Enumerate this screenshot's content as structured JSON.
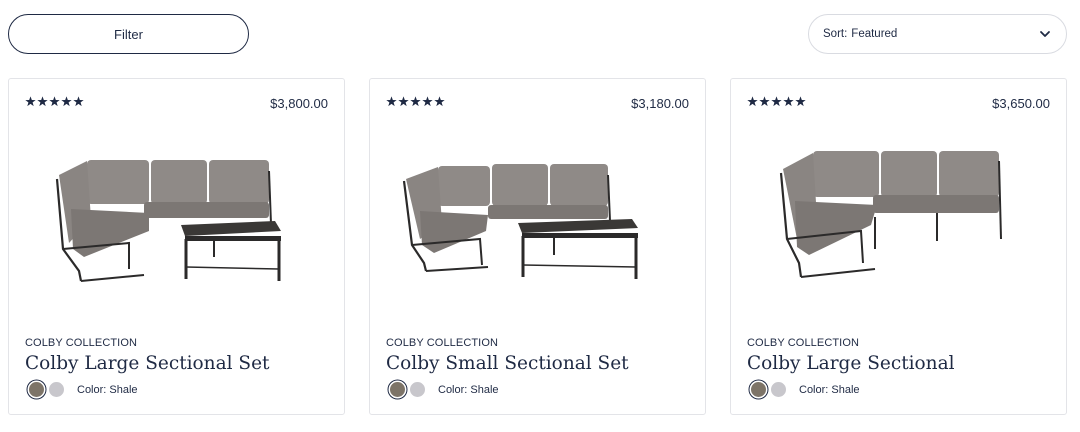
{
  "toolbar": {
    "filter_label": "Filter",
    "sort_label": "Sort:",
    "sort_value": "Featured"
  },
  "products": [
    {
      "rating": 5,
      "price": "$3,800.00",
      "collection": "COLBY COLLECTION",
      "name": "Colby Large Sectional Set",
      "color_label": "Color: Shale",
      "swatches": [
        "#7d7468",
        "#c8c7cc"
      ]
    },
    {
      "rating": 5,
      "price": "$3,180.00",
      "collection": "COLBY COLLECTION",
      "name": "Colby Small Sectional Set",
      "color_label": "Color: Shale",
      "swatches": [
        "#7d7468",
        "#c8c7cc"
      ]
    },
    {
      "rating": 5,
      "price": "$3,650.00",
      "collection": "COLBY COLLECTION",
      "name": "Colby Large Sectional",
      "color_label": "Color: Shale",
      "swatches": [
        "#7d7468",
        "#c8c7cc"
      ]
    }
  ],
  "colors": {
    "text": "#1f2a44",
    "cushion": "#8f8a87",
    "frame": "#2b2a2a"
  },
  "icons": {
    "star": "star-icon",
    "sort_chevron": "chevron-down-icon"
  }
}
